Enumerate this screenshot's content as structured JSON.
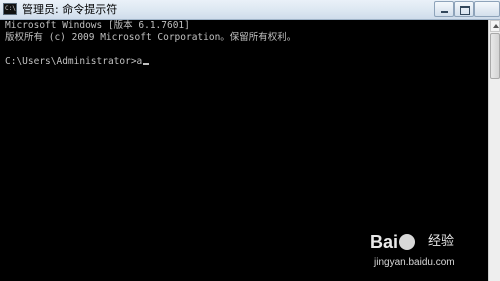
{
  "window": {
    "title": "管理员: 命令提示符",
    "app_icon_text": "C:\\"
  },
  "console": {
    "lines": [
      "Microsoft Windows [版本 6.1.7601]",
      "版权所有 (c) 2009 Microsoft Corporation。保留所有权利。",
      "",
      "C:\\Users\\Administrator>a"
    ]
  },
  "watermark": {
    "logo_text_left": "Bai",
    "logo_text_right": "经验",
    "url": "jingyan.baidu.com"
  },
  "colors": {
    "console_bg": "#000000",
    "console_fg": "#c0c0c0",
    "titlebar_bg": "#dbe6f1"
  }
}
